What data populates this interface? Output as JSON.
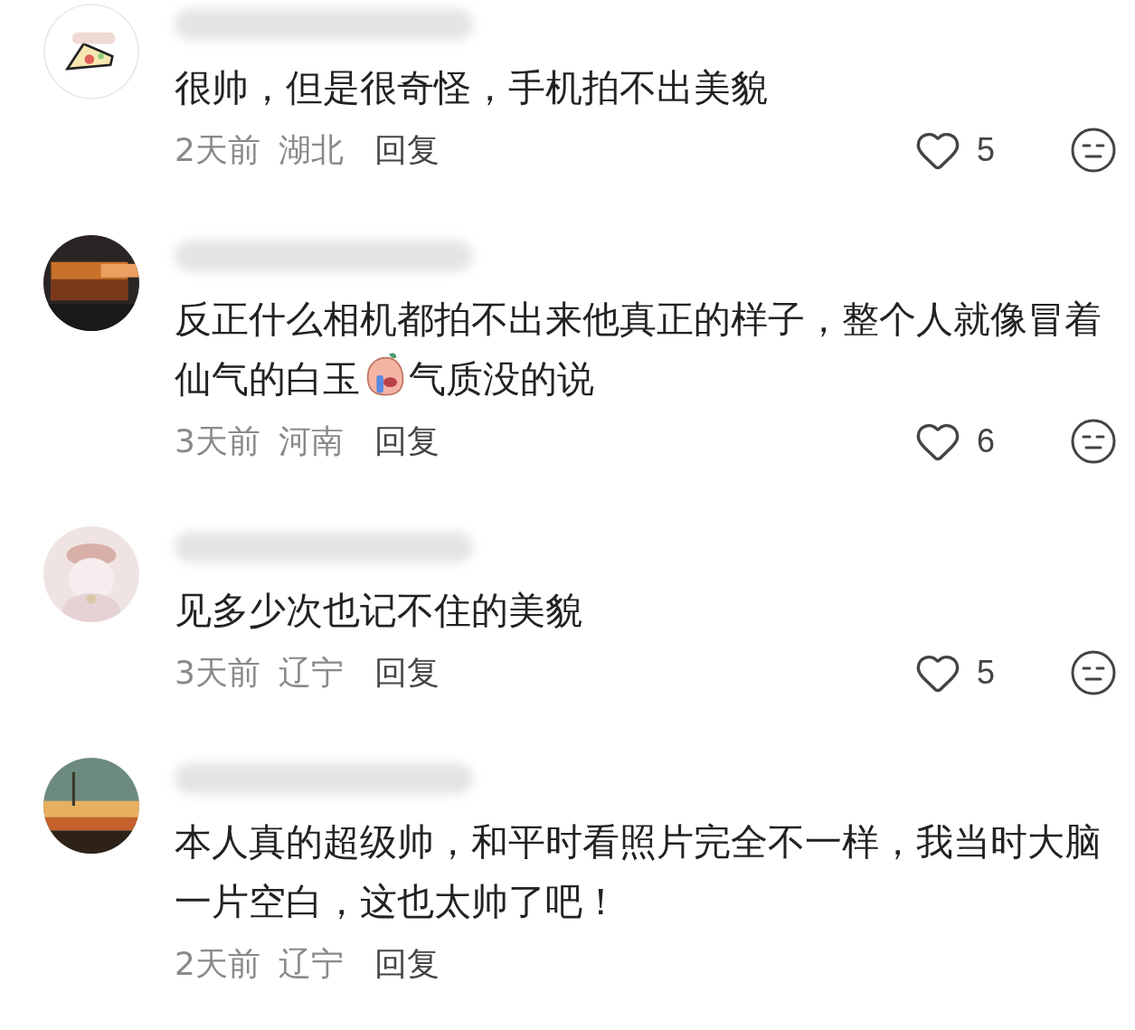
{
  "comments": [
    {
      "body": [
        {
          "kind": "text",
          "text": "很帅，但是很奇怪，手机拍不出美貌"
        }
      ],
      "time": "2天前",
      "region": "湖北",
      "reply": "回复",
      "likes": "5"
    },
    {
      "body": [
        {
          "kind": "text",
          "text": "反正什么相机都拍不出来他真正的样子，整个人就像冒着仙气的白玉"
        },
        {
          "kind": "sticker"
        },
        {
          "kind": "text",
          "text": "气质没的说"
        }
      ],
      "time": "3天前",
      "region": "河南",
      "reply": "回复",
      "likes": "6"
    },
    {
      "body": [
        {
          "kind": "text",
          "text": "见多少次也记不住的美貌"
        }
      ],
      "time": "3天前",
      "region": "辽宁",
      "reply": "回复",
      "likes": "5"
    },
    {
      "body": [
        {
          "kind": "text",
          "text": "本人真的超级帅，和平时看照片完全不一样，我当时大脑一片空白，这也太帅了吧！"
        }
      ],
      "time": "2天前",
      "region": "辽宁",
      "reply": "回复"
    }
  ]
}
